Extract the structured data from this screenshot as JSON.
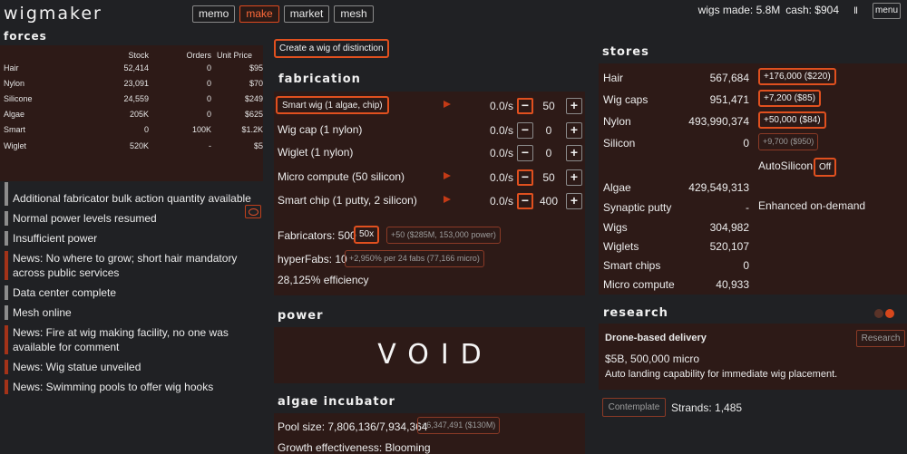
{
  "app": {
    "title": "wigmaker"
  },
  "nav": {
    "tabs": [
      {
        "label": "memo"
      },
      {
        "label": "make"
      },
      {
        "label": "market"
      },
      {
        "label": "mesh"
      }
    ],
    "active": "make"
  },
  "stats": {
    "wigs_made": "wigs made: 5.8M",
    "cash": "cash: $904"
  },
  "controls": {
    "pause": "II",
    "menu": "menu"
  },
  "forces": {
    "title": "forces",
    "columns": [
      "",
      "Stock",
      "Orders",
      "Unit Price"
    ],
    "rows": [
      [
        "Hair",
        "52,414",
        "0",
        "$95"
      ],
      [
        "Nylon",
        "23,091",
        "0",
        "$70"
      ],
      [
        "Silicone",
        "24,559",
        "0",
        "$249"
      ],
      [
        "Algae",
        "205K",
        "0",
        "$625"
      ],
      [
        "Smart",
        "0",
        "100K",
        "$1.2K"
      ],
      [
        "Wiglet",
        "520K",
        "-",
        "$5"
      ]
    ],
    "toggle_icon": "eye-icon"
  },
  "log": [
    {
      "text": "Additional fabricator bulk action quantity available",
      "type": "info"
    },
    {
      "text": "Normal power levels resumed",
      "type": "info"
    },
    {
      "text": "Insufficient power",
      "type": "info"
    },
    {
      "text": "News: No where to grow; short hair mandatory across public services",
      "type": "news"
    },
    {
      "text": "Data center complete",
      "type": "info"
    },
    {
      "text": "Mesh online",
      "type": "info"
    },
    {
      "text": "News: Fire at wig making facility, no one was available for comment",
      "type": "news"
    },
    {
      "text": "News: Wig statue unveiled",
      "type": "news"
    },
    {
      "text": "News: Swimming pools to offer wig hooks",
      "type": "news"
    }
  ],
  "cta": {
    "label": "Create a wig of distinction"
  },
  "fabrication": {
    "title": "fabrication",
    "rows": [
      {
        "name": "Smart wig (1 algae, chip)",
        "rate": "0.0/s",
        "qty": "50",
        "active": true
      },
      {
        "name": "Wig cap (1 nylon)",
        "rate": "0.0/s",
        "qty": "0",
        "active": false
      },
      {
        "name": "Wiglet (1 nylon)",
        "rate": "0.0/s",
        "qty": "0",
        "active": false
      },
      {
        "name": "Micro compute (50 silicon)",
        "rate": "0.0/s",
        "qty": "50",
        "active": true
      },
      {
        "name": "Smart chip (1 putty, 2 silicon)",
        "rate": "0.0/s",
        "qty": "400",
        "active": true
      }
    ],
    "minus": "−",
    "plus": "+",
    "fabricators": "Fabricators: 500",
    "fab_multiplier": "50x",
    "fab_buy": "+50 ($285M, 153,000 power)",
    "hyperfabs": "hyperFabs: 10",
    "hyperfab_buy": "+2,950% per 24 fabs (77,166 micro)",
    "efficiency": "28,125% efficiency"
  },
  "power": {
    "title": "power",
    "value": "VOID"
  },
  "algae": {
    "title": "algae incubator",
    "pool": "Pool size: 7,806,136/7,934,364",
    "pool_buy": "+6,347,491 ($130M)",
    "growth": "Growth effectiveness: Blooming"
  },
  "stores": {
    "title": "stores",
    "rows": [
      {
        "name": "Hair",
        "value": "567,684",
        "buy": "+176,000 ($220)",
        "hot": true
      },
      {
        "name": "Wig caps",
        "value": "951,471",
        "buy": "+7,200 ($85)",
        "hot": true
      },
      {
        "name": "Nylon",
        "value": "493,990,374",
        "buy": "+50,000 ($84)",
        "hot": true
      },
      {
        "name": "Silicon",
        "value": "0",
        "buy": "+9,700 ($950)",
        "hot": false
      },
      {
        "name": "Algae",
        "value": "429,549,313",
        "buy": "",
        "hot": false
      },
      {
        "name": "Synaptic putty",
        "value": "-",
        "buy": "",
        "hot": false
      },
      {
        "name": "Wigs",
        "value": "304,982",
        "buy": "",
        "hot": false
      },
      {
        "name": "Wiglets",
        "value": "520,107",
        "buy": "",
        "hot": false
      },
      {
        "name": "Smart chips",
        "value": "0",
        "buy": "",
        "hot": false
      },
      {
        "name": "Micro compute",
        "value": "40,933",
        "buy": "",
        "hot": false
      }
    ],
    "autosilicon_label": "AutoSilicon",
    "autosilicon_value": "Off",
    "putty_note": "Enhanced on-demand"
  },
  "research": {
    "title": "research",
    "name": "Drone-based delivery",
    "cost": "$5B, 500,000 micro",
    "desc": "Auto landing capability for immediate wig placement.",
    "button": "Research",
    "contemplate": "Contemplate",
    "strands": "Strands: 1,485"
  },
  "colors": {
    "accent": "#e0501f",
    "panel": "#2d1a17",
    "bg": "#202124"
  }
}
